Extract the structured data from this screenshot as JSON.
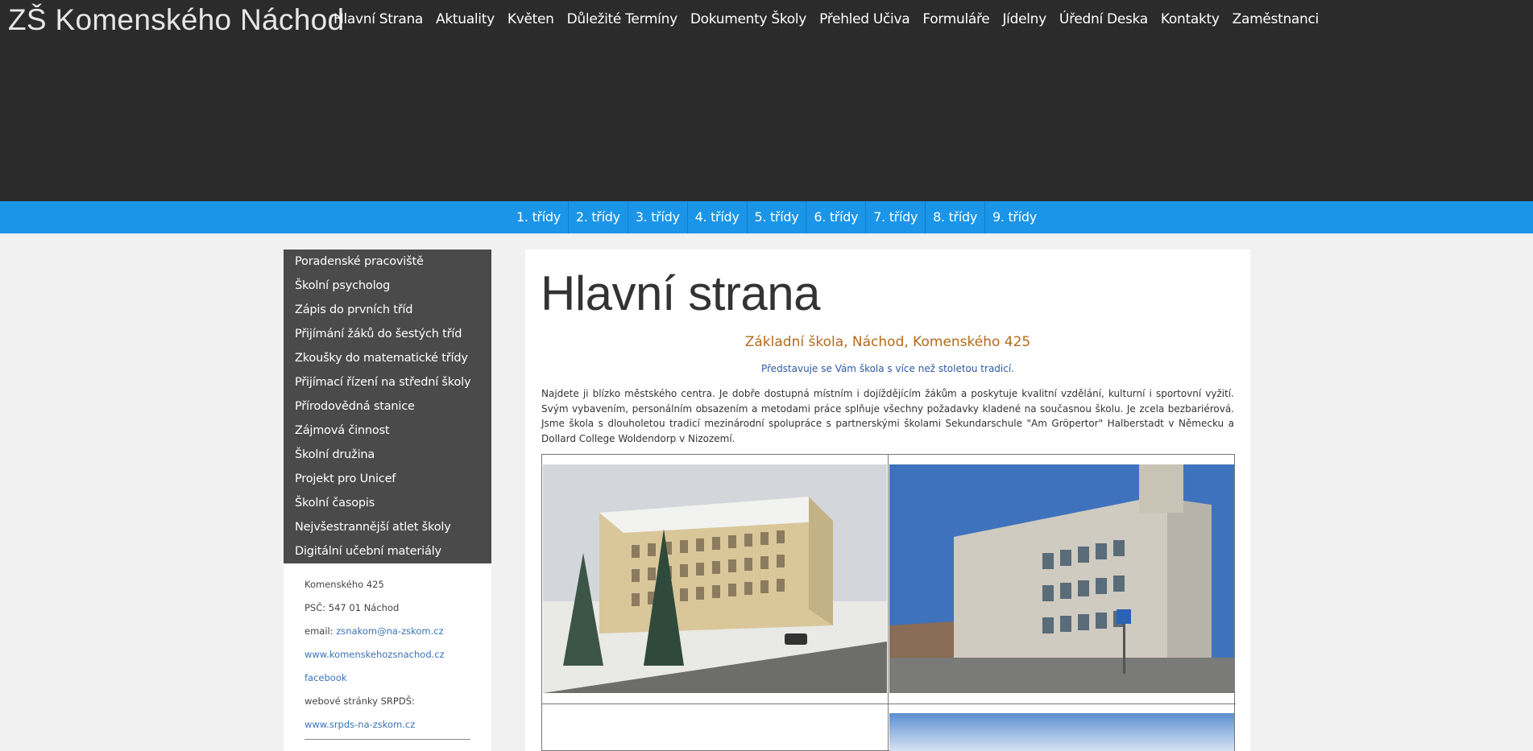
{
  "header": {
    "logo": "ZŠ Komenského Náchod",
    "nav": [
      "Hlavní Strana",
      "Aktuality",
      "Květen",
      "Důležité Termíny",
      "Dokumenty Školy",
      "Přehled Učiva",
      "Formuláře",
      "Jídelny",
      "Úřední Deska",
      "Kontakty",
      "Zaměstnanci"
    ]
  },
  "classes": [
    "1. třídy",
    "2. třídy",
    "3. třídy",
    "4. třídy",
    "5. třídy",
    "6. třídy",
    "7. třídy",
    "8. třídy",
    "9. třídy"
  ],
  "sidebar": {
    "items": [
      "Poradenské pracoviště",
      "Školní psycholog",
      "Zápis do prvních tříd",
      "Přijímání žáků do šestých tříd",
      "Zkoušky do matematické třídy",
      "Přijímací řízení na střední školy",
      "Přírodovědná stanice",
      "Zájmová činnost",
      "Školní družina",
      "Projekt pro Unicef",
      "Školní časopis",
      "Nejvšestrannější atlet školy",
      "Digitální učební materiály"
    ],
    "contact": {
      "street": "Komenského 425",
      "city": "PSČ: 547 01 Náchod",
      "email_label": "email: ",
      "email": "zsnakom@na-zskom.cz",
      "website": "www.komenskehozsnachod.cz",
      "facebook": "facebook",
      "srpds_label": "webové stránky SRPDŠ:",
      "srpds_url": "www.srpds-na-zskom.cz"
    }
  },
  "main": {
    "title": "Hlavní strana",
    "subtitle": "Základní škola, Náchod, Komenského 425",
    "tagline": "Představuje se Vám škola s více než stoletou tradicí.",
    "intro": "Najdete ji blízko městského centra. Je dobře dostupná místním i dojíždějícím žákům a poskytuje kvalitní vzdělání, kulturní i sportovní vyžití. Svým vybavením, personálním obsazením a metodami práce splňuje všechny požadavky kladené na současnou školu. Je zcela bezbariérová. Jsme škola s dlouholetou tradicí mezinárodní spolupráce s partnerskými školami Sekundarschule \"Am Gröpertor\" Halberstadt v Německu a Dollard College Woldendorp v Nizozemí."
  },
  "colors": {
    "header_bg": "#2b2b2b",
    "classbar_bg": "#1a95e8",
    "sidebar_bg": "#4a4a4a",
    "subtitle": "#b36b1d",
    "link": "#3a73b8"
  }
}
